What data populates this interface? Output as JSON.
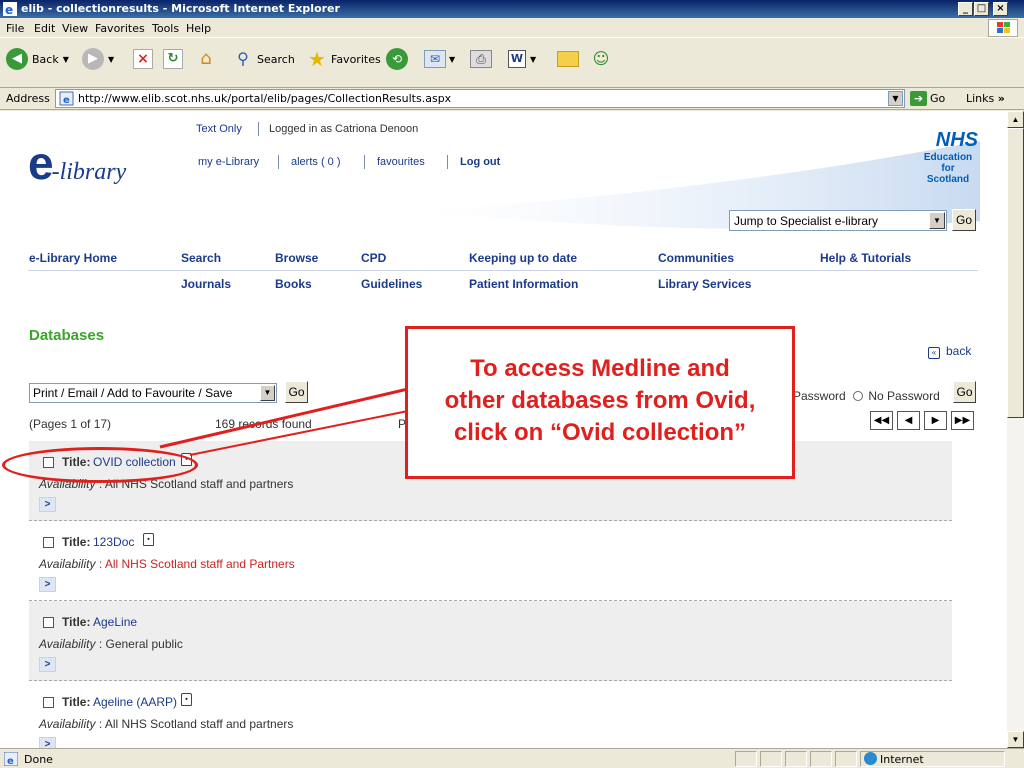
{
  "window": {
    "title": "elib - collectionresults - Microsoft Internet Explorer",
    "minimize": "_",
    "maximize": "□",
    "close": "×"
  },
  "menu": [
    "File",
    "Edit",
    "View",
    "Favorites",
    "Tools",
    "Help"
  ],
  "toolbar": {
    "back": "Back",
    "search": "Search",
    "favorites": "Favorites"
  },
  "address": {
    "label": "Address",
    "url": "http://www.elib.scot.nhs.uk/portal/elib/pages/CollectionResults.aspx",
    "go": "Go",
    "links": "Links",
    "links_more": "»"
  },
  "header": {
    "logo_e": "e",
    "logo_rest": "-library",
    "text_only": "Text Only",
    "logged_in": "Logged in as Catriona Denoon",
    "my_elibrary": "my e-Library",
    "alerts": "alerts ( 0 )",
    "favourites": "favourites",
    "logout": "Log out",
    "nhs": "NHS",
    "nhs_sub1": "Education",
    "nhs_sub2": "for",
    "nhs_sub3": "Scotland",
    "jump_select": "Jump to Specialist e-library",
    "jump_go": "Go"
  },
  "nav": {
    "row1": [
      "e-Library Home",
      "Search",
      "Browse",
      "CPD",
      "Keeping up to date",
      "Communities",
      "Help & Tutorials"
    ],
    "row2": [
      "Journals",
      "Books",
      "Guidelines",
      "Patient Information",
      "Library Services"
    ]
  },
  "databases": {
    "heading": "Databases",
    "back": "back",
    "action_select": "Print / Email / Add to Favourite / Save",
    "action_go": "Go",
    "pages": "(Pages 1 of 17)",
    "records": "169 records found",
    "records_p": "P",
    "password_filter": "Password",
    "no_password": "No Password",
    "filter_go": "Go",
    "pager": [
      "◀◀",
      "◀",
      "▶",
      "▶▶"
    ]
  },
  "results": [
    {
      "title_label": "Title:",
      "title": "OVID collection",
      "locked": true,
      "avail_label": "Availability",
      "availability": " : All NHS Scotland staff and partners",
      "highlight": false
    },
    {
      "title_label": "Title:",
      "title": "123Doc",
      "locked": true,
      "avail_label": "Availability",
      "availability": " : All NHS Scotland staff and Partners",
      "highlight": true
    },
    {
      "title_label": "Title:",
      "title": "AgeLine",
      "locked": false,
      "avail_label": "Availability",
      "availability": " : General public",
      "highlight": false
    },
    {
      "title_label": "Title:",
      "title": "Ageline (AARP)",
      "locked": true,
      "avail_label": "Availability",
      "availability": " : All NHS Scotland staff and partners",
      "highlight": false
    }
  ],
  "expand_glyph": ">",
  "callout": {
    "line1": "To access Medline and",
    "line2": "other databases from Ovid,",
    "line3": "click on “Ovid collection”"
  },
  "status": {
    "done": "Done",
    "zone": "Internet"
  },
  "colors": {
    "accent": "#1a3a8a",
    "heading": "#3aa52a",
    "callout": "#e0201c",
    "nhs": "#005eb8"
  }
}
